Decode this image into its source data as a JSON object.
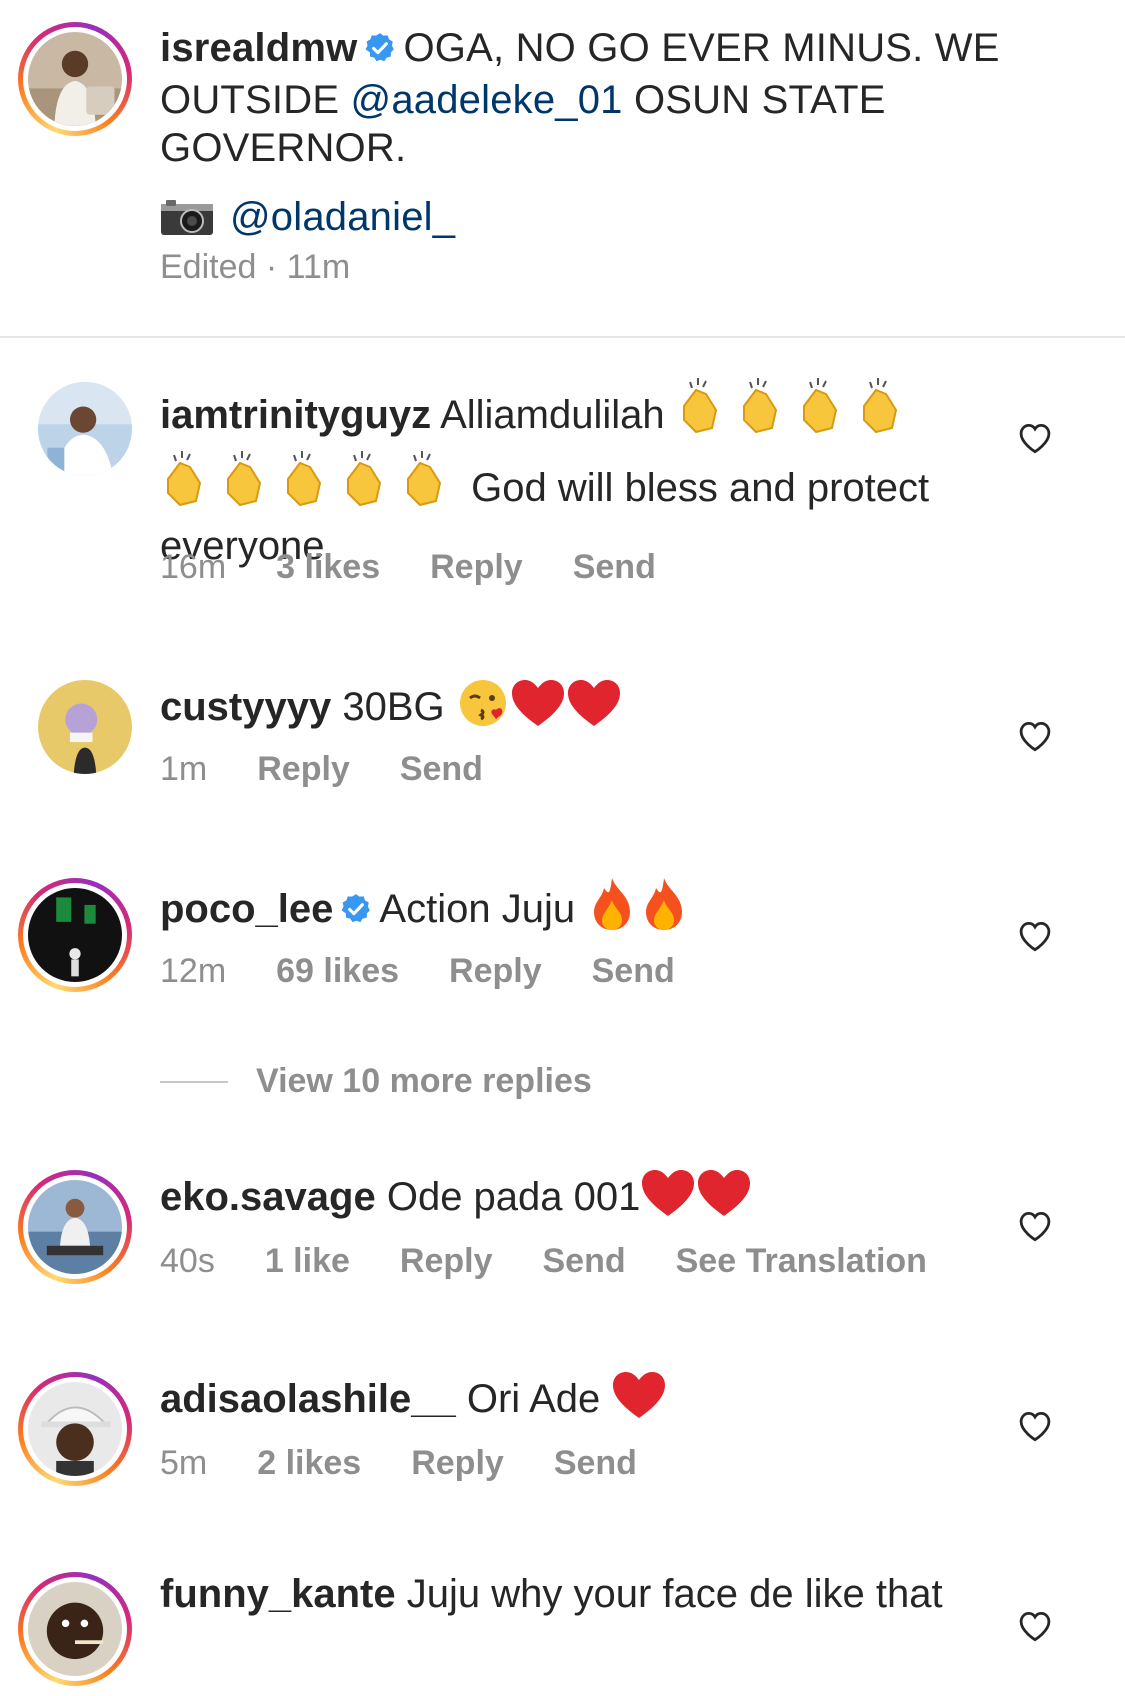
{
  "caption": {
    "username": "isrealdmw",
    "text_part1": "OGA, NO GO EVER MINUS. WE OUTSIDE ",
    "mention1": "@aadeleke_01",
    "text_part2": "  OSUN STATE GOVERNOR.",
    "mention2": "@oladaniel_",
    "meta": "Edited · 11m"
  },
  "comments": [
    {
      "username": "iamtrinityguyz",
      "text_a": "Alliamdulilah",
      "text_b": "God will bless and protect everyone",
      "time": "16m",
      "likes": "3 likes",
      "reply": "Reply",
      "send": "Send"
    },
    {
      "username": "custyyyy",
      "text": "30BG",
      "time": "1m",
      "reply": "Reply",
      "send": "Send"
    },
    {
      "username": "poco_lee",
      "text": "Action Juju",
      "time": "12m",
      "likes": "69 likes",
      "reply": "Reply",
      "send": "Send"
    },
    {
      "username": "eko.savage",
      "text": "Ode pada 001",
      "time": "40s",
      "likes": "1 like",
      "reply": "Reply",
      "send": "Send",
      "translate": "See Translation"
    },
    {
      "username": "adisaolashile__",
      "text": "Ori Ade",
      "time": "5m",
      "likes": "2 likes",
      "reply": "Reply",
      "send": "Send"
    },
    {
      "username": "funny_kante",
      "text": "Juju why your face de like that"
    }
  ],
  "view_more": "View 10 more replies",
  "colors": {
    "text": "#262626",
    "secondary": "#8e8e8e",
    "mention": "#00376b",
    "verified": "#3897f0"
  }
}
